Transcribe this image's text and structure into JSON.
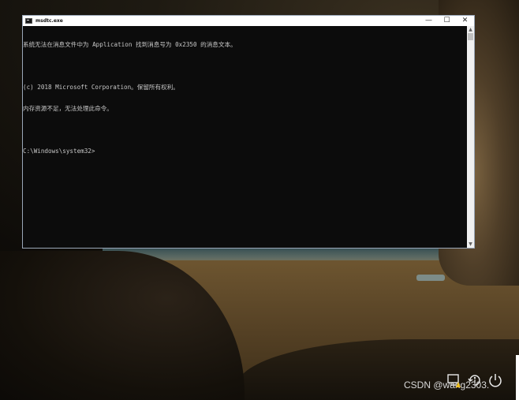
{
  "window": {
    "title": "msdtc.exe",
    "minimize_glyph": "—",
    "maximize_glyph": "☐",
    "close_glyph": "✕"
  },
  "console": {
    "lines": [
      "系统无法在消息文件中为 Application 找到消息号为 0x2350 的消息文本。",
      "",
      "(c) 2018 Microsoft Corporation。保留所有权利。",
      "内存资源不足，无法处理此命令。",
      "",
      "C:\\Windows\\system32>"
    ]
  },
  "watermark": "CSDN @wang2303.",
  "tray": {
    "icons": [
      "network-warning-icon",
      "accessibility-icon",
      "power-icon"
    ]
  }
}
